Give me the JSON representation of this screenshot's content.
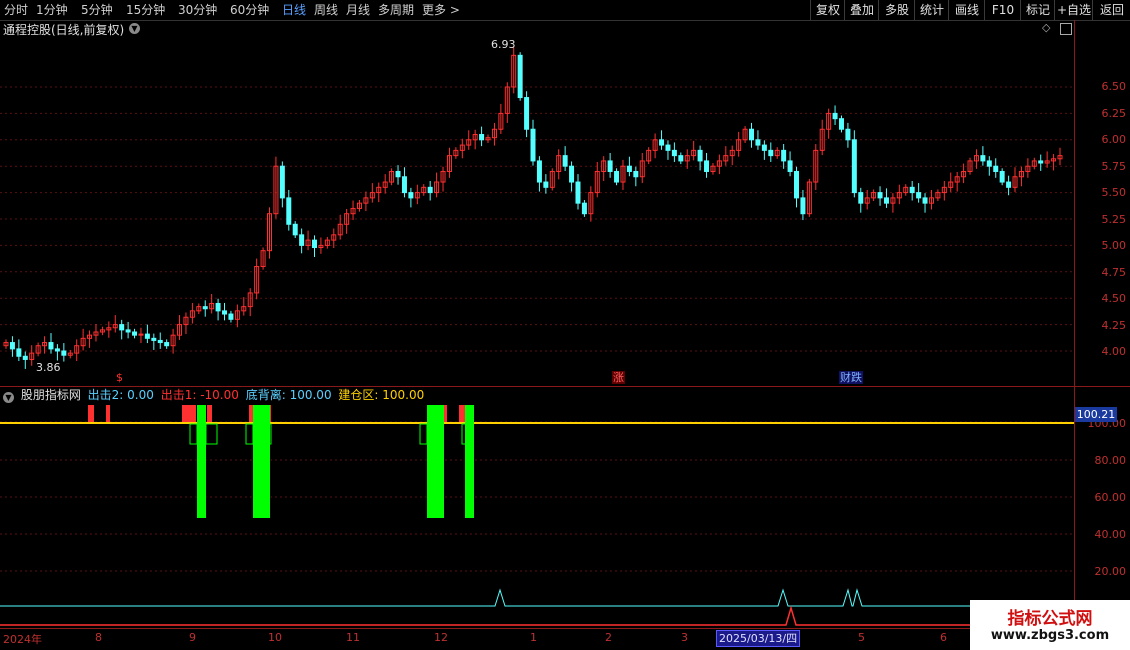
{
  "toolbar": {
    "periods": [
      "分时",
      "1分钟",
      "5分钟",
      "15分钟",
      "30分钟",
      "60分钟",
      "日线",
      "周线",
      "月线",
      "多周期",
      "更多 >"
    ],
    "active_period": "日线",
    "right_buttons": [
      "复权",
      "叠加",
      "多股",
      "统计",
      "画线",
      "F10",
      "标记",
      "+自选",
      "返回"
    ]
  },
  "chart_title": "通程控股(日线,前复权)",
  "price_axis": [
    "6.50",
    "6.25",
    "6.00",
    "5.75",
    "5.50",
    "5.25",
    "5.00",
    "4.75",
    "4.50",
    "4.25",
    "4.00"
  ],
  "high_label": "6.93",
  "low_label": "3.86",
  "events": [
    {
      "text": "$",
      "color": "#ff3030"
    },
    {
      "text": "涨",
      "color": "#ff5050"
    },
    {
      "text": "财跌",
      "color": "#7fb0ff"
    }
  ],
  "indicator": {
    "name": "股朋指标网",
    "labels": [
      {
        "text": "出击2: 0.00",
        "color": "#5ad0ff"
      },
      {
        "text": "出击1: -10.00",
        "color": "#ff3030"
      },
      {
        "text": "底背离: 100.00",
        "color": "#5ad0ff"
      },
      {
        "text": "建仓区: 100.00",
        "color": "#ffd000"
      }
    ],
    "axis": [
      "100.00",
      "80.00",
      "60.00",
      "40.00",
      "20.00"
    ],
    "current_value": "100.21"
  },
  "x_axis": [
    "2024年",
    "8",
    "9",
    "10",
    "11",
    "12",
    "1",
    "2",
    "3",
    "4",
    "5",
    "6"
  ],
  "cursor_date": "2025/03/13/四",
  "watermark": {
    "line1": "指标公式网",
    "line2": "www.zbgs3.com"
  },
  "colors": {
    "up": "#ff3030",
    "down": "#54ffff",
    "bg": "#000000",
    "grid": "#5a1010",
    "yellow": "#ffd000",
    "green": "#00ff00"
  },
  "chart_data": {
    "type": "candlestick",
    "title": "通程控股(日线,前复权)",
    "x_range": [
      "2024-07",
      "2025-06"
    ],
    "y_range": [
      3.75,
      6.95
    ],
    "closes": [
      4.08,
      4.02,
      3.95,
      3.92,
      3.98,
      4.05,
      4.08,
      4.02,
      4.0,
      3.96,
      3.98,
      4.05,
      4.12,
      4.15,
      4.18,
      4.2,
      4.22,
      4.25,
      4.2,
      4.18,
      4.15,
      4.16,
      4.12,
      4.1,
      4.08,
      4.05,
      4.15,
      4.25,
      4.32,
      4.38,
      4.42,
      4.4,
      4.45,
      4.38,
      4.35,
      4.3,
      4.38,
      4.42,
      4.55,
      4.8,
      4.95,
      5.3,
      5.75,
      5.45,
      5.2,
      5.1,
      5.0,
      5.05,
      4.98,
      5.0,
      5.05,
      5.1,
      5.2,
      5.3,
      5.35,
      5.4,
      5.45,
      5.5,
      5.55,
      5.6,
      5.7,
      5.65,
      5.5,
      5.45,
      5.5,
      5.55,
      5.5,
      5.6,
      5.7,
      5.85,
      5.9,
      5.95,
      6.0,
      6.05,
      6.0,
      6.02,
      6.1,
      6.25,
      6.5,
      6.8,
      6.4,
      6.1,
      5.8,
      5.6,
      5.55,
      5.7,
      5.85,
      5.75,
      5.6,
      5.4,
      5.3,
      5.5,
      5.7,
      5.8,
      5.7,
      5.6,
      5.75,
      5.7,
      5.65,
      5.8,
      5.9,
      6.0,
      5.95,
      5.9,
      5.85,
      5.8,
      5.85,
      5.9,
      5.8,
      5.7,
      5.75,
      5.8,
      5.85,
      5.9,
      6.0,
      6.1,
      6.0,
      5.95,
      5.9,
      5.85,
      5.9,
      5.8,
      5.7,
      5.45,
      5.3,
      5.6,
      5.9,
      6.1,
      6.25,
      6.2,
      6.1,
      6.0,
      5.5,
      5.4,
      5.45,
      5.5,
      5.45,
      5.4,
      5.45,
      5.5,
      5.55,
      5.5,
      5.45,
      5.4,
      5.45,
      5.5,
      5.55,
      5.6,
      5.65,
      5.7,
      5.8,
      5.85,
      5.8,
      5.75,
      5.7,
      5.6,
      5.55,
      5.65,
      5.7,
      5.75,
      5.8,
      5.78,
      5.8,
      5.82,
      5.85
    ]
  }
}
